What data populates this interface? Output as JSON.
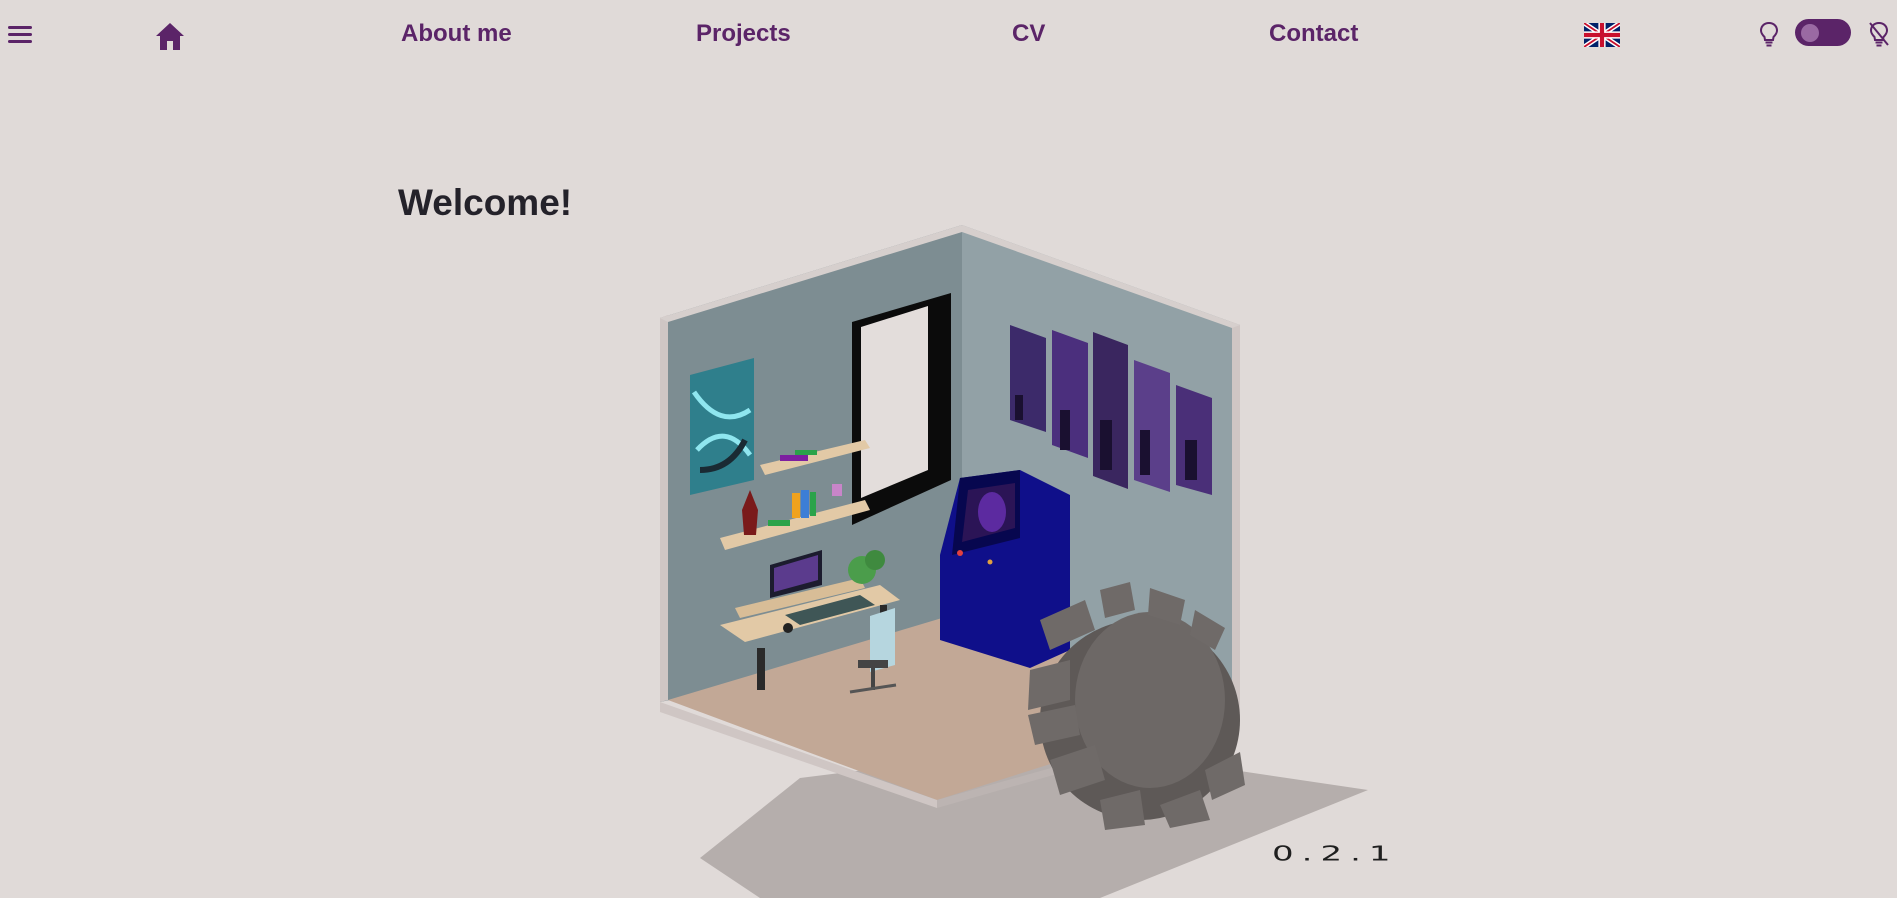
{
  "nav": {
    "menu_icon": "hamburger-menu-icon",
    "home_icon": "home-icon",
    "links": [
      {
        "label": "About me"
      },
      {
        "label": "Projects"
      },
      {
        "label": "CV"
      },
      {
        "label": "Contact"
      }
    ],
    "language_icon": "uk-flag-icon",
    "theme_toggle": {
      "left_icon": "lightbulb-icon",
      "right_icon": "lightbulb-off-icon",
      "state": "light"
    }
  },
  "main": {
    "heading": "Welcome!"
  },
  "scene": {
    "description_icon": "isometric-room-3d-scene",
    "version": "0.2.1"
  },
  "colors": {
    "accent": "#5b2468",
    "background": "#e0dad8",
    "heading": "#24222a"
  }
}
